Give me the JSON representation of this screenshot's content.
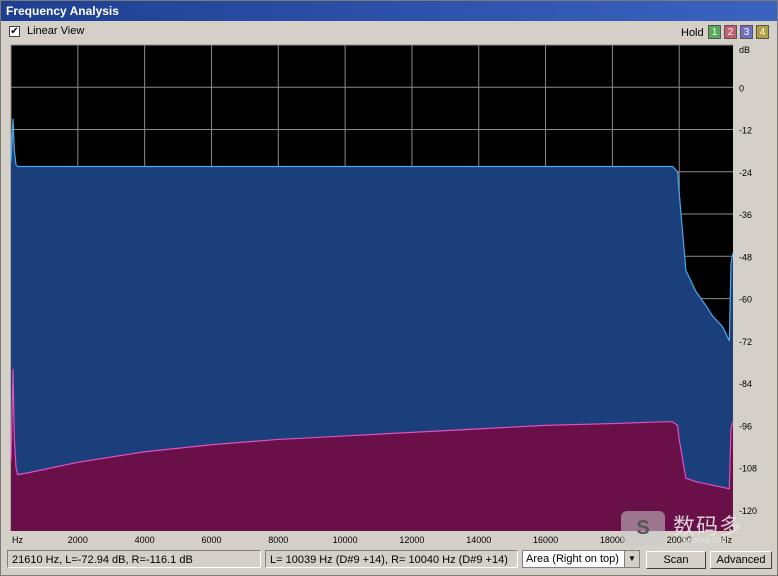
{
  "window": {
    "title": "Frequency Analysis"
  },
  "toolbar": {
    "linear_view_checked": true,
    "check_mark": "✔",
    "linear_view_label": "Linear View",
    "hold_label": "Hold",
    "hold_buttons": [
      {
        "label": "1",
        "color": "#5aa85a"
      },
      {
        "label": "2",
        "color": "#c06070"
      },
      {
        "label": "3",
        "color": "#7070c8"
      },
      {
        "label": "4",
        "color": "#b0a040"
      }
    ]
  },
  "chart_data": {
    "type": "area",
    "xlabel": "Hz",
    "ylabel": "dB",
    "xlim": [
      0,
      21610
    ],
    "ylim": [
      -126,
      12
    ],
    "x_ticks": [
      "Hz",
      "2000",
      "4000",
      "6000",
      "8000",
      "10000",
      "12000",
      "14000",
      "16000",
      "18000",
      "20000",
      "Hz"
    ],
    "y_ticks": [
      "dB",
      "0",
      "-12",
      "-24",
      "-36",
      "-48",
      "-60",
      "-72",
      "-84",
      "-96",
      "-108",
      "-120"
    ],
    "grid": true,
    "series": [
      {
        "color": "#1a3f7a",
        "line_color": "#4aa8e8",
        "x": [
          0,
          60,
          100,
          150,
          200,
          1000,
          5000,
          10000,
          15000,
          19500,
          19800,
          19950,
          20000,
          20200,
          20500,
          20800,
          21000,
          21300,
          21500,
          21550,
          21610
        ],
        "y": [
          -21,
          -9,
          -18,
          -22,
          -22.5,
          -22.5,
          -22.5,
          -22.5,
          -22.5,
          -22.5,
          -22.5,
          -24,
          -30,
          -52,
          -58,
          -62,
          -65,
          -68,
          -72,
          -50,
          -47
        ]
      },
      {
        "color": "#6a1048",
        "line_color": "#e050c0",
        "x": [
          0,
          60,
          100,
          150,
          200,
          500,
          1000,
          2000,
          4000,
          6000,
          8000,
          10000,
          12000,
          14000,
          16000,
          18000,
          19500,
          19800,
          19950,
          20000,
          20200,
          20500,
          21000,
          21500,
          21550,
          21610
        ],
        "y": [
          -106,
          -80,
          -100,
          -108,
          -110,
          -109.5,
          -108.5,
          -106.5,
          -103.5,
          -101.5,
          -100,
          -99,
          -98,
          -97,
          -96,
          -95.5,
          -95,
          -95,
          -96,
          -100,
          -111,
          -112,
          -113,
          -114,
          -97,
          -95
        ]
      }
    ]
  },
  "status": {
    "cursor_readout": "21610 Hz, L=-72.94 dB, R=-116.1 dB",
    "peak_readout": "L=  10039 Hz (D#9 +14), R=  10040 Hz (D#9 +14)",
    "view_mode": "Area (Right on top)",
    "select_arrow": "▼",
    "scan_label": "Scan",
    "advanced_label": "Advanced"
  },
  "watermark": {
    "logo": "S",
    "text": "数码多",
    "site": "Sooma.com"
  }
}
